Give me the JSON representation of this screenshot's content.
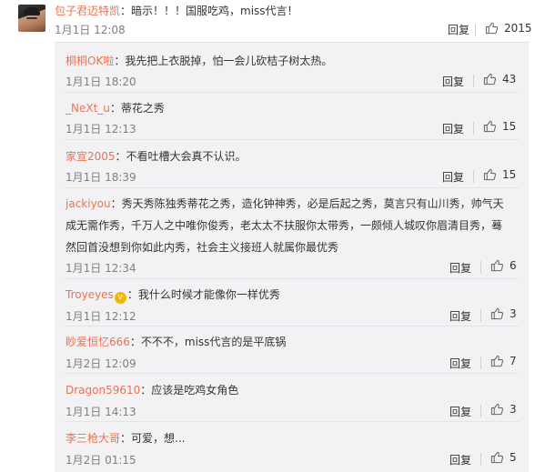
{
  "top": {
    "user": "包子君迈特凯",
    "text": "：暗示！！！国服吃鸡，miss代言！",
    "time": "1月1日 12:08",
    "reply_label": "回复",
    "likes": "2015"
  },
  "replies": [
    {
      "user": "桐桐OK啦",
      "text": "：我先把上衣脱掉，怕一会儿砍桔子树太热。",
      "time": "1月1日 18:20",
      "likes": "43"
    },
    {
      "user": "_NeXt_u",
      "text": "：蒂花之秀",
      "time": "1月1日 12:13",
      "likes": "15"
    },
    {
      "user": "家宣2005",
      "text": "：不看吐槽大会真不认识。",
      "time": "1月1日 18:39",
      "likes": "15"
    },
    {
      "user": "jackiyou",
      "text": "：秀天秀陈独秀蒂花之秀，造化钟神秀，必是后起之秀，莫言只有山川秀，帅气天成无需作秀，千万人之中唯你俊秀，老太太不扶服你太带秀，一颇倾人城叹你眉清目秀，蓦然回首没想到你如此内秀，社会主义接班人就属你最优秀",
      "time": "1月1日 12:34",
      "likes": "6"
    },
    {
      "user": "Troyeyes",
      "text": "：我什么时候才能像你一样优秀",
      "time": "1月1日 12:12",
      "likes": "3"
    },
    {
      "user": "眇爱恒忆666",
      "text": "：不不不，miss代言的是平底锅",
      "time": "1月2日 12:09",
      "likes": "7"
    },
    {
      "user": "Dragon59610",
      "text": "：应该是吃鸡女角色",
      "time": "1月1日 14:13",
      "likes": "3"
    },
    {
      "user": "李三枪大哥",
      "text": "：可爱，想...",
      "time": "1月2日 01:15",
      "likes": "5"
    }
  ],
  "reply_label": "回复",
  "icons": {
    "like": "thumbs-up-icon",
    "vip": "vip-badge-icon"
  },
  "colors": {
    "username": "#eb7350",
    "panel": "#f2f2f5",
    "time": "#808080"
  }
}
